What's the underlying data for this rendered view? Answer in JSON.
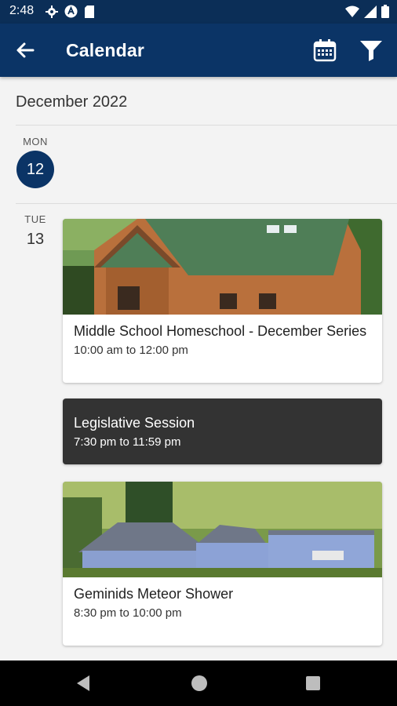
{
  "status_bar": {
    "time": "2:48",
    "icons_left": [
      "gear-icon",
      "a-badge-icon",
      "sd-card-icon"
    ],
    "icons_right": [
      "wifi-icon",
      "signal-icon",
      "battery-icon"
    ]
  },
  "app_bar": {
    "title": "Calendar",
    "back_icon": "arrow-left-icon",
    "calendar_icon": "calendar-icon",
    "filter_icon": "filter-icon",
    "color": "#0b3466"
  },
  "month": "December 2022",
  "days": [
    {
      "dow": "MON",
      "day": "12",
      "selected": true,
      "events": []
    },
    {
      "dow": "TUE",
      "day": "13",
      "selected": false,
      "events": [
        {
          "title": "Middle School Homeschool - December Series",
          "time": "10:00 am to 12:00 pm",
          "has_image": true,
          "image": "wooden-building-green-roof"
        },
        {
          "title": "Legislative Session",
          "time": "7:30 pm to 11:59 pm",
          "has_image": false,
          "style": "dark"
        },
        {
          "title": "Geminids Meteor Shower",
          "time": "8:30 pm to 10:00 pm",
          "has_image": true,
          "image": "blue-buildings-forest"
        }
      ]
    }
  ],
  "nav_bar": {
    "back": "triangle-back-icon",
    "home": "circle-home-icon",
    "recents": "square-recents-icon"
  }
}
